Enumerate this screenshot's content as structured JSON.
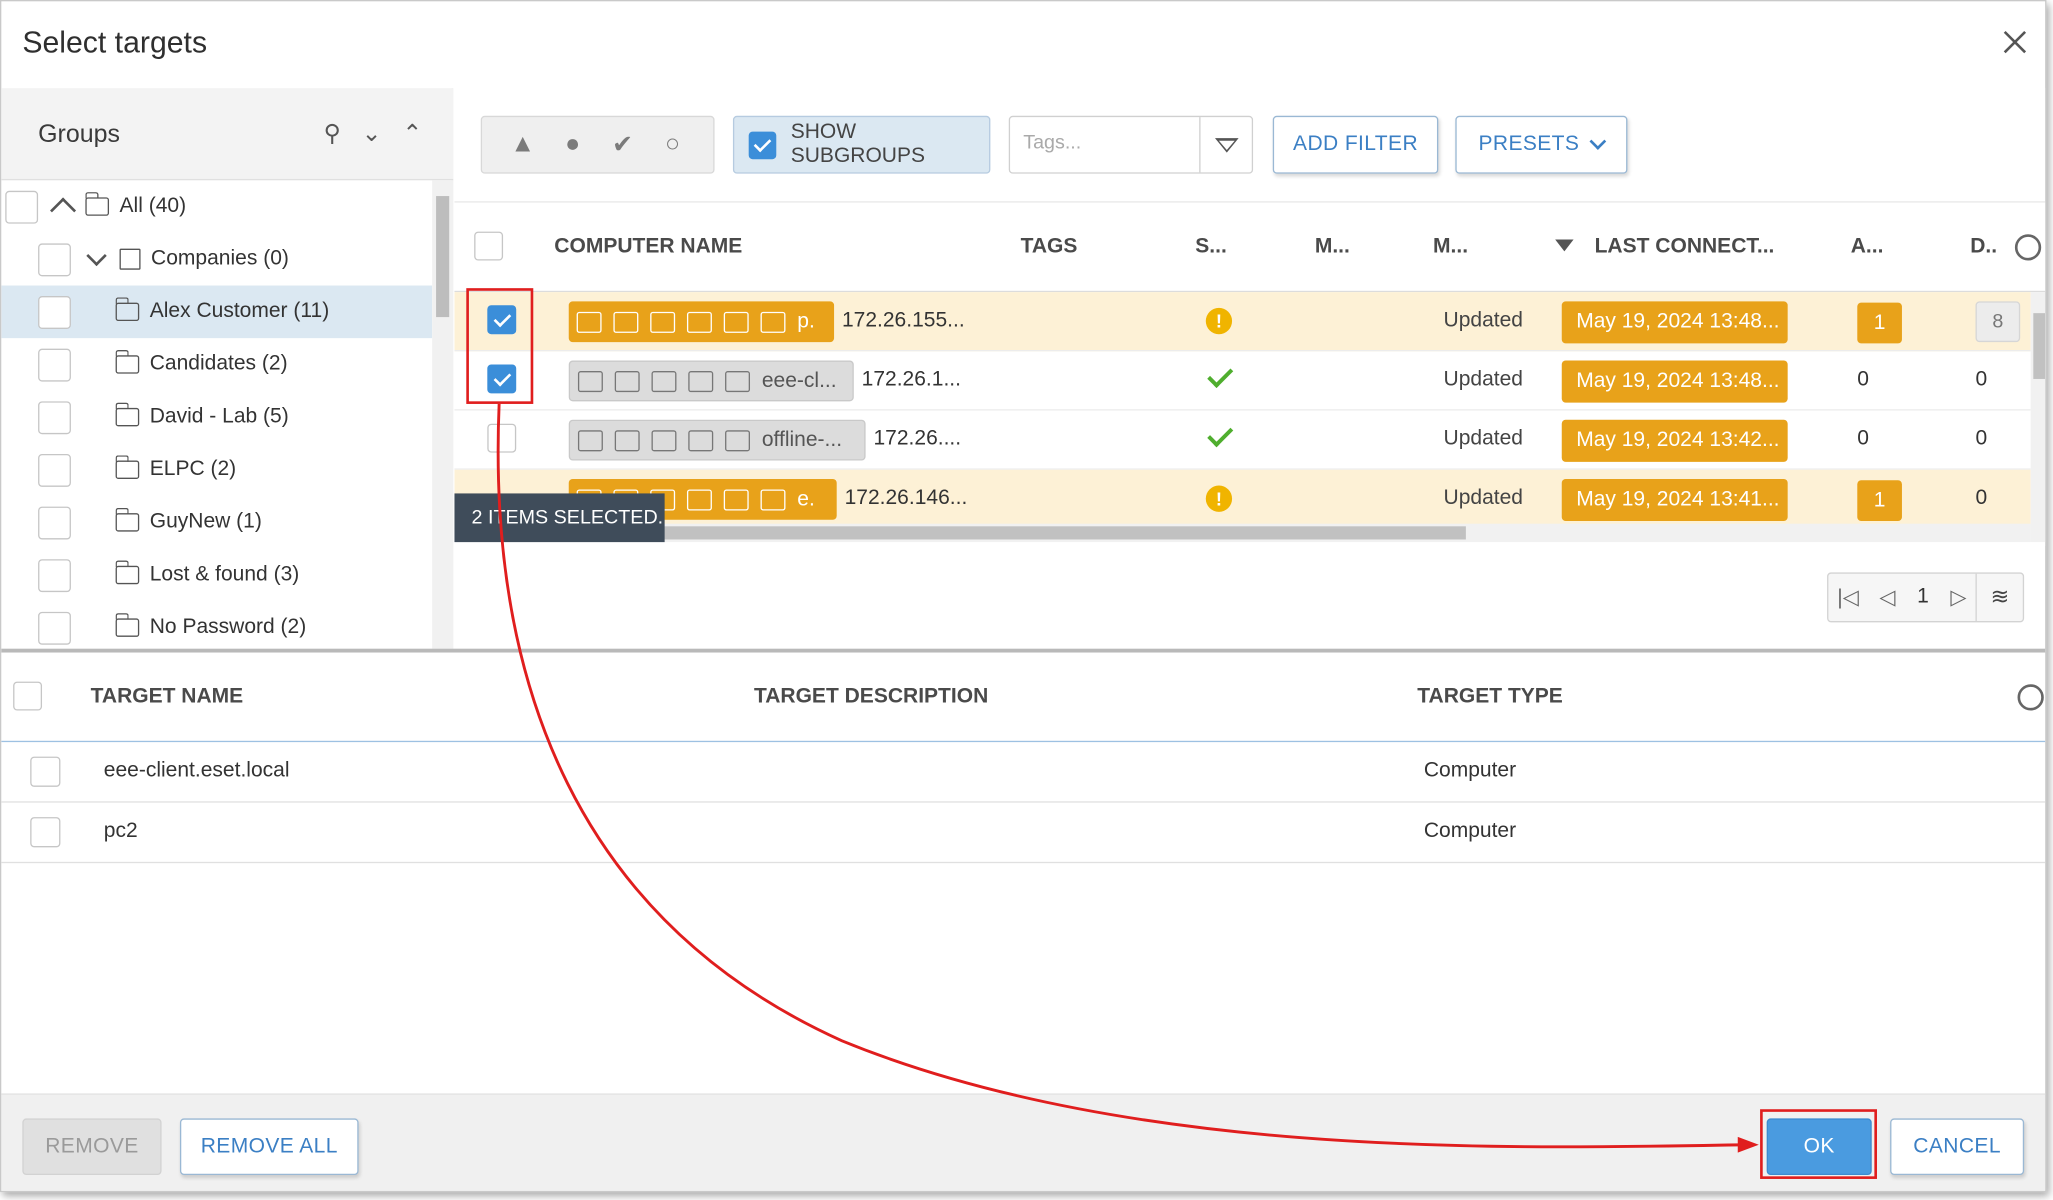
{
  "dialog": {
    "title": "Select targets"
  },
  "groups": {
    "title": "Groups",
    "items": [
      {
        "label": "All (40)"
      },
      {
        "label": "Companies (0)"
      },
      {
        "label": "Alex Customer (11)"
      },
      {
        "label": "Candidates (2)"
      },
      {
        "label": "David - Lab (5)"
      },
      {
        "label": "ELPC (2)"
      },
      {
        "label": "GuyNew (1)"
      },
      {
        "label": "Lost & found (3)"
      },
      {
        "label": "No Password (2)"
      }
    ]
  },
  "toolbar": {
    "show_subgroups": "SHOW SUBGROUPS",
    "tags_placeholder": "Tags...",
    "add_filter": "ADD FILTER",
    "presets": "PRESETS"
  },
  "computers": {
    "columns": [
      "COMPUTER NAME",
      "TAGS",
      "S...",
      "M...",
      "M...",
      "LAST CONNECT...",
      "A...",
      "D.."
    ],
    "rows": [
      {
        "name": "p.",
        "ip": "172.26.155...",
        "status": "warning",
        "module": "Updated",
        "last_connected": "May 19, 2024 13:48...",
        "alerts": "1",
        "detections": "8"
      },
      {
        "name": "eee-cl...",
        "ip": "172.26.1...",
        "status": "ok",
        "module": "Updated",
        "last_connected": "May 19, 2024 13:48...",
        "alerts": "0",
        "detections": "0"
      },
      {
        "name": "offline-...",
        "ip": "172.26....",
        "status": "ok",
        "module": "Updated",
        "last_connected": "May 19, 2024 13:42...",
        "alerts": "0",
        "detections": "0"
      },
      {
        "name": "e.",
        "ip": "172.26.146...",
        "status": "warning",
        "module": "Updated",
        "last_connected": "May 19, 2024 13:41...",
        "alerts": "1",
        "detections": "0"
      }
    ],
    "selection_tooltip": "2 ITEMS SELECTED.",
    "page": "1"
  },
  "targets": {
    "columns": [
      "TARGET NAME",
      "TARGET DESCRIPTION",
      "TARGET TYPE"
    ],
    "rows": [
      {
        "name": "eee-client.eset.local",
        "description": "",
        "type": "Computer"
      },
      {
        "name": "pc2",
        "description": "",
        "type": "Computer"
      }
    ]
  },
  "footer": {
    "remove": "REMOVE",
    "remove_all": "REMOVE ALL",
    "ok": "OK",
    "cancel": "CANCEL"
  },
  "colors": {
    "accent": "#3b8ed9",
    "warning_orange": "#e8a21a",
    "annotation_red": "#e01e1e"
  }
}
